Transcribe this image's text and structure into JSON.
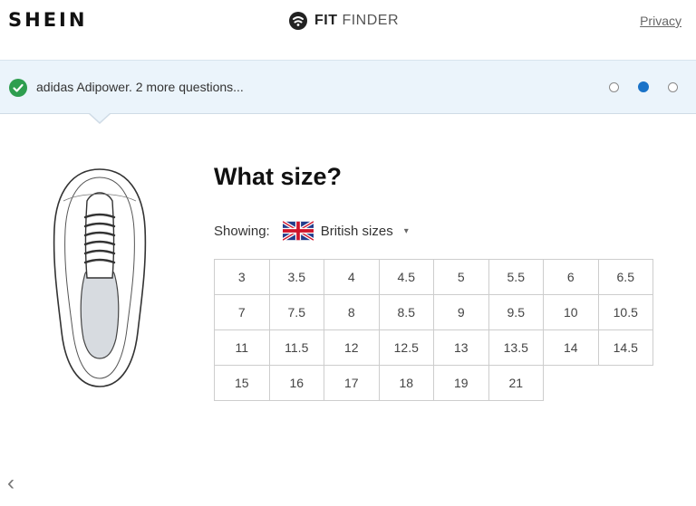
{
  "header": {
    "brand": "SHEIN",
    "fit_finder_bold": "FIT",
    "fit_finder_rest": " FINDER",
    "privacy_label": "Privacy"
  },
  "banner": {
    "message": "adidas Adipower. 2 more questions...",
    "steps": 3,
    "active_step": 2
  },
  "main": {
    "title": "What size?",
    "showing_label": "Showing:",
    "size_system": "British sizes",
    "sizes": [
      "3",
      "3.5",
      "4",
      "4.5",
      "5",
      "5.5",
      "6",
      "6.5",
      "7",
      "7.5",
      "8",
      "8.5",
      "9",
      "9.5",
      "10",
      "10.5",
      "11",
      "11.5",
      "12",
      "12.5",
      "13",
      "13.5",
      "14",
      "14.5",
      "15",
      "16",
      "17",
      "18",
      "19",
      "21"
    ]
  },
  "nav": {
    "back_icon": "chevron-left-icon"
  },
  "colors": {
    "accent": "#1a73c8",
    "banner_bg": "#ebf4fb",
    "check": "#2e9e4f"
  }
}
